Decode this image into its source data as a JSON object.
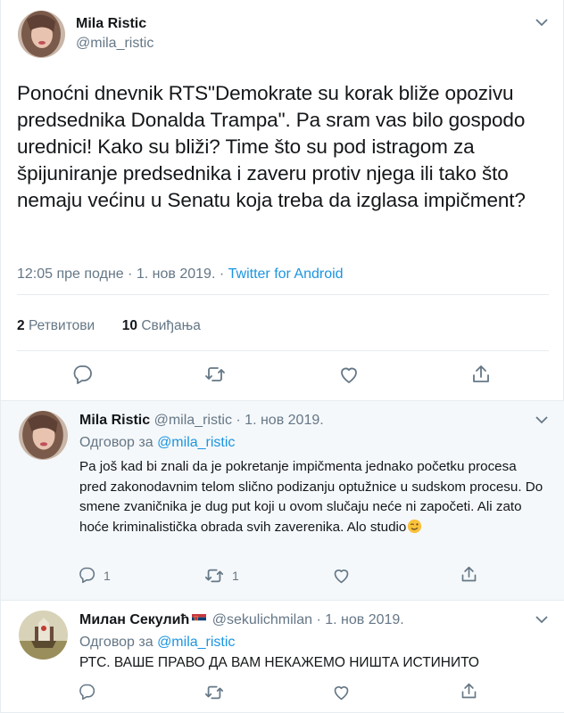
{
  "main_tweet": {
    "author_name": "Mila Ristic",
    "author_handle": "@mila_ristic",
    "text": "Ponoćni dnevnik RTS\"Demokrate su korak bliže opozivu predsednika Donalda Trampa\". Pa sram vas bilo gospodo urednici! Kako su bliži? Time što su pod istragom za špijuniranje predsednika i zaveru protiv njega ili tako što nemaju većinu u Senatu koja treba da izglasa impičment?",
    "timestamp": "12:05 пре подне · 1. нов 2019.",
    "separator": " · ",
    "source": "Twitter for Android",
    "retweets_count": "2",
    "retweets_label": "Ретвитови",
    "likes_count": "10",
    "likes_label": "Свиђања"
  },
  "replies": [
    {
      "author_name": "Mila Ristic",
      "author_handle": "@mila_ristic",
      "date": "· 1. нов 2019.",
      "reply_to_label": "Одговор за",
      "reply_to_handle": "@mila_ristic",
      "text": "Pa još kad bi znali da je pokretanje impičmenta jednako početku procesa pred zakonodavnim telom slično podizanju optužnice u sudskom procesu. Do smene zvaničnika je dug put koji u ovom slučaju neće ni započeti. Ali zato hoće kriminalistička obrada svih zaverenika. Alo studio",
      "emoji": "winking-face",
      "reply_count": "1",
      "retweet_count": "1",
      "like_count": ""
    },
    {
      "author_name": "Милан Секулић",
      "author_flag": "serbia-flag",
      "author_handle": "@sekulichmilan",
      "date": "· 1. нов 2019.",
      "reply_to_label": "Одговор за",
      "reply_to_handle": "@mila_ristic",
      "text": "РТС. ВАШЕ ПРАВО ДА ВАМ НЕКАЖЕМО НИШТА ИСТИНИТО",
      "reply_count": "",
      "retweet_count": "",
      "like_count": ""
    }
  ],
  "colors": {
    "link": "#1b95e0",
    "muted": "#657786",
    "text": "#14171a",
    "reply_bg": "#f5f8fa"
  }
}
